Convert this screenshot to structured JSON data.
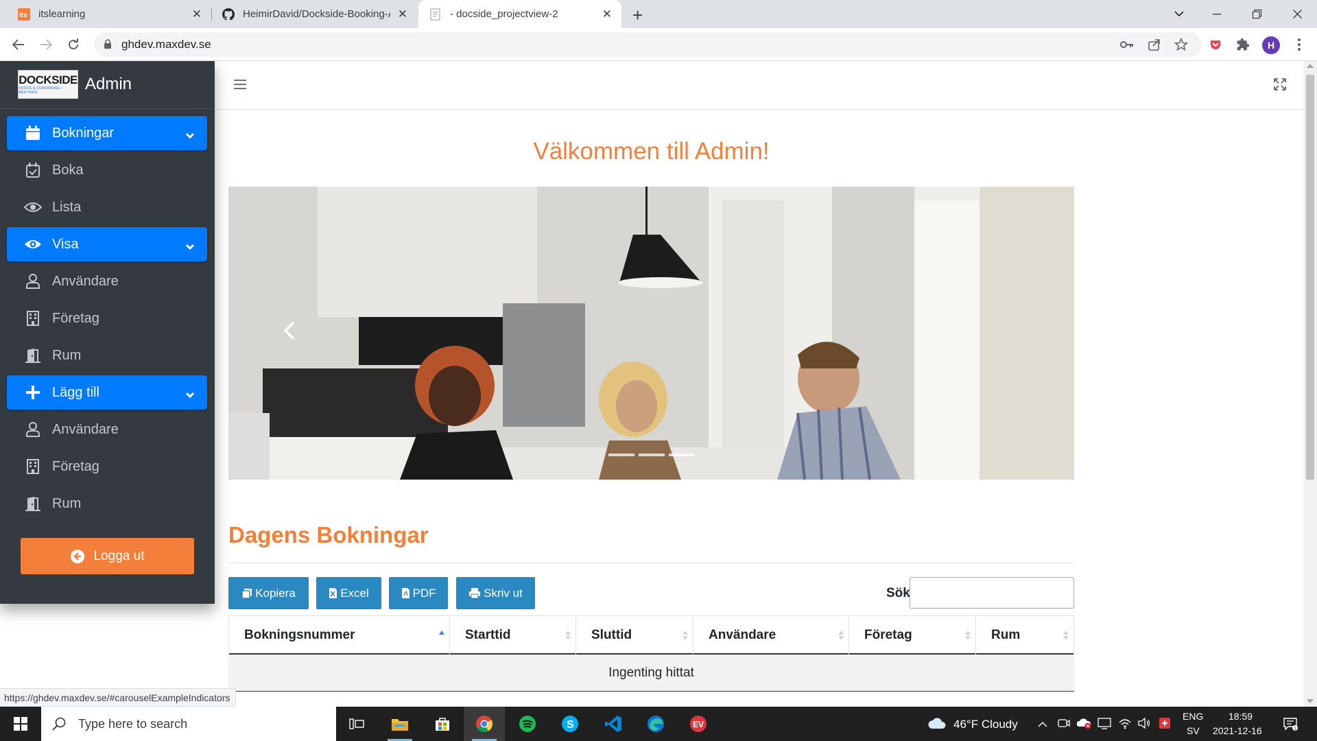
{
  "browser": {
    "tabs": [
      {
        "title": "itslearning",
        "icon": "itslearning-icon",
        "active": false
      },
      {
        "title": "HeimirDavid/Dockside-Booking-A",
        "icon": "github-icon",
        "active": false
      },
      {
        "title": "- docside_projectview-2",
        "icon": "document-icon",
        "active": true
      }
    ],
    "new_tab_label": "+",
    "url": "ghdev.maxdev.se",
    "profile_initial": "H",
    "status_url": "https://ghdev.maxdev.se/#carouselExampleIndicators"
  },
  "sidebar": {
    "brand_logo_top": "DOCKSIDE",
    "brand_logo_bottom": "OFFICE & COWORKING • MEETINGS",
    "brand_title": "Admin",
    "items": [
      {
        "label": "Bokningar",
        "icon": "calendar-icon",
        "header": true
      },
      {
        "label": "Boka",
        "icon": "calendar-check-icon",
        "header": false
      },
      {
        "label": "Lista",
        "icon": "eye-icon",
        "header": false
      },
      {
        "label": "Visa",
        "icon": "eye-icon",
        "header": true
      },
      {
        "label": "Användare",
        "icon": "user-icon",
        "header": false
      },
      {
        "label": "Företag",
        "icon": "building-icon",
        "header": false
      },
      {
        "label": "Rum",
        "icon": "door-icon",
        "header": false
      },
      {
        "label": "Lägg till",
        "icon": "plus-icon",
        "header": true
      },
      {
        "label": "Användare",
        "icon": "user-icon",
        "header": false
      },
      {
        "label": "Företag",
        "icon": "building-icon",
        "header": false
      },
      {
        "label": "Rum",
        "icon": "door-icon",
        "header": false
      }
    ],
    "logout_label": "Logga ut"
  },
  "main": {
    "welcome_title": "Välkommen till Admin!",
    "section_title": "Dagens Bokningar",
    "buttons": [
      {
        "label": "Kopiera",
        "icon": "copy-icon"
      },
      {
        "label": "Excel",
        "icon": "file-excel-icon"
      },
      {
        "label": "PDF",
        "icon": "file-pdf-icon"
      },
      {
        "label": "Skriv ut",
        "icon": "print-icon"
      }
    ],
    "search_label": "Sök",
    "search_value": "",
    "table": {
      "columns": [
        "Bokningsnummer",
        "Starttid",
        "Sluttid",
        "Användare",
        "Företag",
        "Rum"
      ],
      "empty_text": "Ingenting hittat"
    }
  },
  "taskbar": {
    "search_placeholder": "Type here to search",
    "weather": "46°F  Cloudy",
    "lang_top": "ENG",
    "lang_bottom": "SV",
    "time": "18:59",
    "date": "2021-12-16"
  },
  "colors": {
    "accent_orange": "#f47f3b",
    "sidebar_bg": "#343a40",
    "header_blue": "#007bff",
    "button_blue": "#2b89c2"
  }
}
